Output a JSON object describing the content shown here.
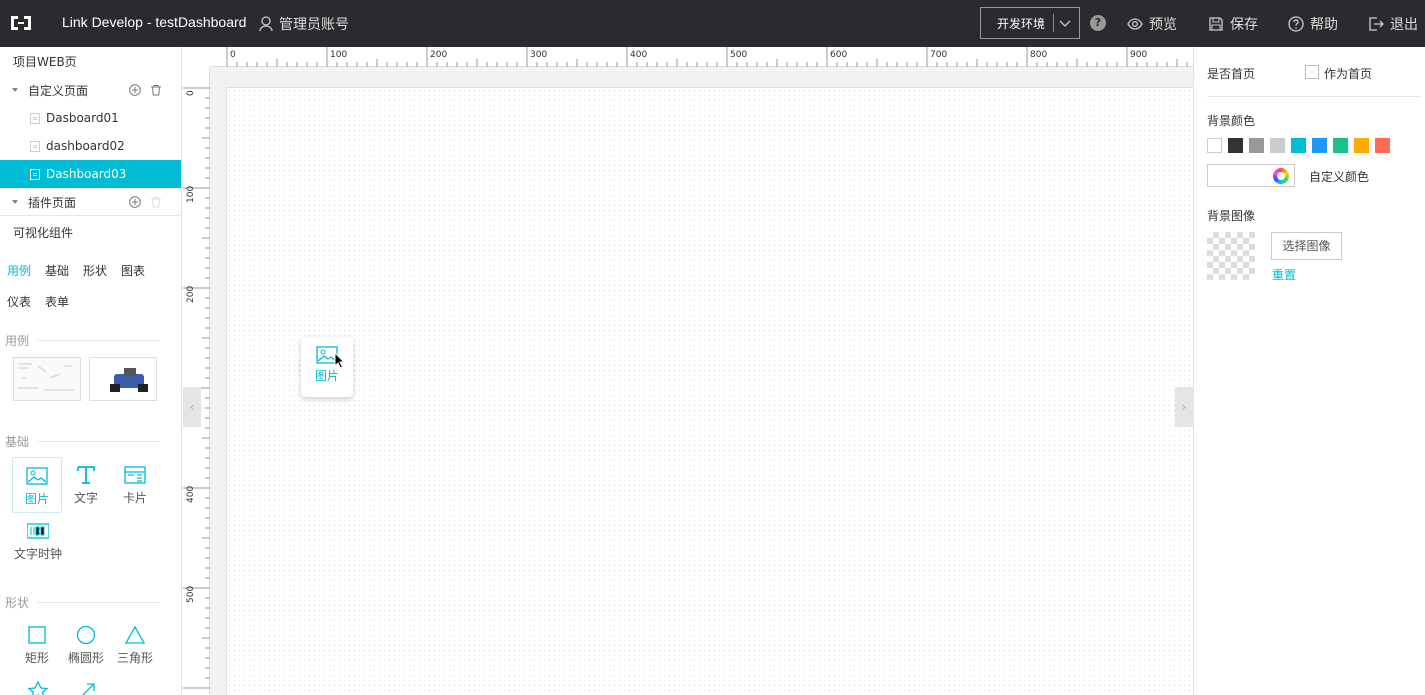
{
  "header": {
    "title": "Link Develop - testDashboard",
    "account": "管理员账号",
    "env": "开发环境",
    "help_badge": "?",
    "actions": {
      "preview": "预览",
      "save": "保存",
      "help": "帮助",
      "logout": "退出"
    }
  },
  "sidebar": {
    "project_title": "项目WEB页",
    "custom_pages": {
      "label": "自定义页面",
      "pages": [
        "Dasboard01",
        "dashboard02",
        "Dashboard03"
      ],
      "active_index": 2
    },
    "plugin_pages": {
      "label": "插件页面"
    },
    "components_title": "可视化组件",
    "tabs_row1": [
      "用例",
      "基础",
      "形状",
      "图表"
    ],
    "tabs_row2": [
      "仪表",
      "表单"
    ],
    "active_tab": "用例",
    "groups": {
      "examples": "用例",
      "basic": "基础",
      "shapes": "形状"
    },
    "basic_items": [
      {
        "label": "图片",
        "icon": "image-icon"
      },
      {
        "label": "文字",
        "icon": "text-icon"
      },
      {
        "label": "卡片",
        "icon": "card-icon"
      },
      {
        "label": "文字时钟",
        "icon": "clock-icon"
      }
    ],
    "shape_items": [
      {
        "label": "矩形",
        "icon": "rectangle-icon"
      },
      {
        "label": "椭圆形",
        "icon": "ellipse-icon"
      },
      {
        "label": "三角形",
        "icon": "triangle-icon"
      }
    ]
  },
  "canvas": {
    "ruler_h": [
      "0",
      "100",
      "200",
      "300",
      "400",
      "500",
      "600",
      "700",
      "800",
      "900"
    ],
    "ruler_v": [
      "0",
      "100",
      "200",
      "400",
      "500"
    ],
    "drag_item_label": "图片"
  },
  "properties": {
    "homepage_label": "是否首页",
    "homepage_checkbox": "作为首页",
    "bg_color_label": "背景颜色",
    "swatches": [
      "#ffffff",
      "#333333",
      "#999999",
      "#cccccc",
      "#00bcd4",
      "#2196f3",
      "#1dbf8e",
      "#ffaa00",
      "#ff6b55"
    ],
    "custom_color": "自定义颜色",
    "bg_image_label": "背景图像",
    "choose_image": "选择图像",
    "reset": "重置"
  },
  "accent_color": "#00bcd4"
}
